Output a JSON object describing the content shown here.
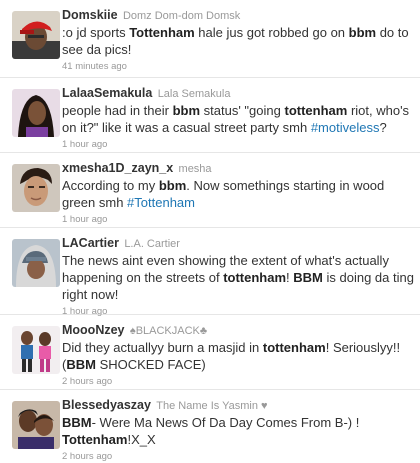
{
  "tweets": [
    {
      "username": "Domskiie",
      "fullname": "Domz Dom-dom Domsk",
      "segments": [
        {
          "t": ":o jd sports "
        },
        {
          "t": "Tottenham",
          "b": true
        },
        {
          "t": " hale jus got robbed go on "
        },
        {
          "t": "bbm",
          "b": true
        },
        {
          "t": " do to see da pics!"
        }
      ],
      "time": "41 minutes ago",
      "avatar": "avatar-red-cap"
    },
    {
      "username": "LalaaSemakula",
      "fullname": "Lala Semakula",
      "segments": [
        {
          "t": "people had in their "
        },
        {
          "t": "bbm",
          "b": true
        },
        {
          "t": " status' \"going "
        },
        {
          "t": "tottenham",
          "b": true
        },
        {
          "t": " riot, who's on it?\" like it was a casual street party smh "
        },
        {
          "t": "#motiveless",
          "h": true
        },
        {
          "t": "?"
        }
      ],
      "time": "1 hour ago",
      "avatar": "avatar-girl-purple"
    },
    {
      "username": "xmesha1D_zayn_x",
      "fullname": "mesha",
      "segments": [
        {
          "t": "According to my "
        },
        {
          "t": "bbm",
          "b": true
        },
        {
          "t": ". Now somethings starting in wood green smh "
        },
        {
          "t": "#Tottenham",
          "h": true
        }
      ],
      "time": "1 hour ago",
      "avatar": "avatar-boy"
    },
    {
      "username": "LACartier",
      "fullname": "L.A. Cartier",
      "segments": [
        {
          "t": "The news aint even showing the extent of what's actually happening on the streets of "
        },
        {
          "t": "tottenham",
          "b": true
        },
        {
          "t": "! "
        },
        {
          "t": "BBM",
          "b": true
        },
        {
          "t": " is doing da ting right now!"
        }
      ],
      "time": "1 hour ago",
      "avatar": "avatar-hood"
    },
    {
      "username": "MoooNzey",
      "fullname": "♠BLACKJACK♣",
      "segments": [
        {
          "t": "Did they actuallyy burn a masjid in "
        },
        {
          "t": "tottenham",
          "b": true
        },
        {
          "t": "! Seriouslyy!! ("
        },
        {
          "t": "BBM",
          "b": true
        },
        {
          "t": " SHOCKED FACE)"
        }
      ],
      "time": "2 hours ago",
      "avatar": "avatar-two-girls"
    },
    {
      "username": "Blessedyaszay",
      "fullname": "The Name Is Yasmin ♥",
      "segments": [
        {
          "t": "BBM",
          "b": true
        },
        {
          "t": "- Were Ma News Of Da Day Comes From B-) ! "
        },
        {
          "t": "Tottenham",
          "b": true
        },
        {
          "t": "!X_X"
        }
      ],
      "time": "2 hours ago",
      "avatar": "avatar-couple"
    }
  ],
  "colors": {
    "username": "#333333",
    "fullname": "#999999",
    "text": "#333333",
    "hashtag": "#1f77b4",
    "timestamp": "#999999",
    "divider": "#e6e6e6"
  }
}
